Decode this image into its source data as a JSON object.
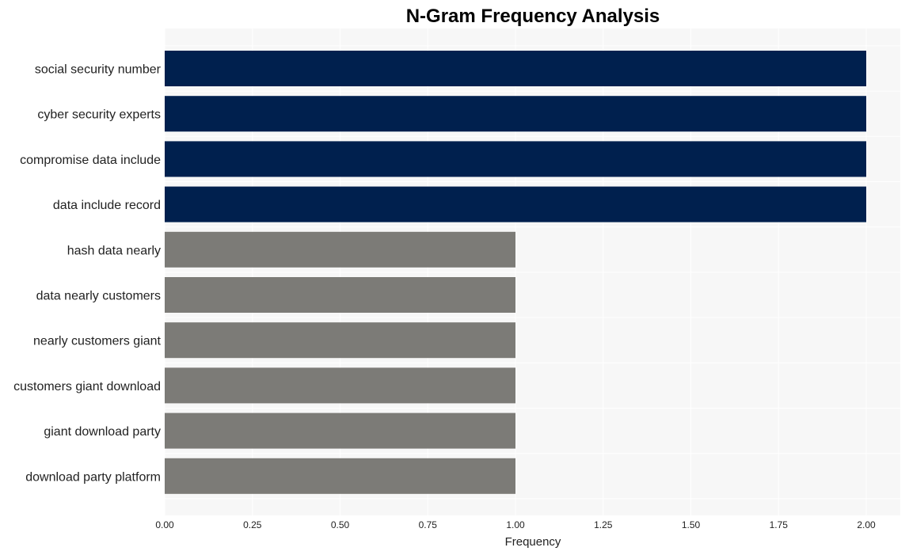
{
  "chart_data": {
    "type": "bar",
    "orientation": "horizontal",
    "title": "N-Gram Frequency Analysis",
    "xlabel": "Frequency",
    "ylabel": "",
    "xlim": [
      0,
      2.1
    ],
    "xticks": [
      0.0,
      0.25,
      0.5,
      0.75,
      1.0,
      1.25,
      1.5,
      1.75,
      2.0
    ],
    "xtick_labels": [
      "0.00",
      "0.25",
      "0.50",
      "0.75",
      "1.00",
      "1.25",
      "1.50",
      "1.75",
      "2.00"
    ],
    "grid": true,
    "categories": [
      "social security number",
      "cyber security experts",
      "compromise data include",
      "data include record",
      "hash data nearly",
      "data nearly customers",
      "nearly customers giant",
      "customers giant download",
      "giant download party",
      "download party platform"
    ],
    "values": [
      2,
      2,
      2,
      2,
      1,
      1,
      1,
      1,
      1,
      1
    ],
    "colors": {
      "high": "#00204e",
      "low": "#7c7b77",
      "plot_background": "#f7f7f7",
      "grid": "#ffffff"
    }
  }
}
